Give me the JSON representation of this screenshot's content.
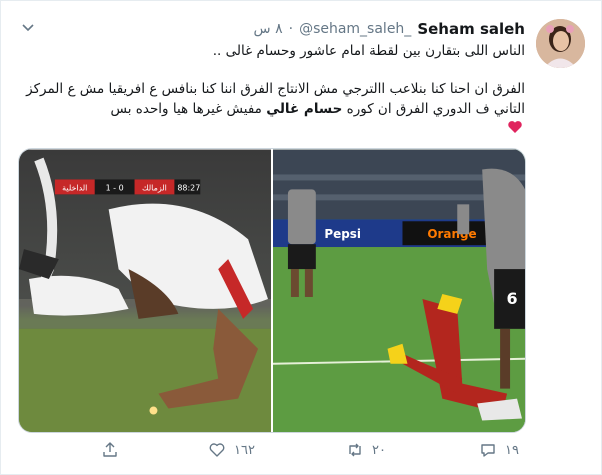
{
  "tweet": {
    "author_name": "Seham saleh",
    "author_handle": "@seham_saleh_",
    "separator": "·",
    "time": "٨ س",
    "text_line1": "الناس اللى بتقارن بين لقطة امام عاشور وحسام غالى ..",
    "text_para2_part1": "الفرق ان احنا كنا بنلاعب االترجي مش الانتاج الفرق اننا كنا بنافس ع افريقيا مش ع المركز التاني ف الدوري الفرق ان كوره ",
    "text_para2_bold": "حسام غالي",
    "text_para2_part2": " مفيش غيرها هيا واحده بس"
  },
  "media": {
    "left_image": {
      "scoreboard_minute": "88:27",
      "scoreboard_home": "الزمالك",
      "scoreboard_score": "1 - 0",
      "scoreboard_away": "الداخلية"
    },
    "right_image": {
      "banner_left": "Pepsi",
      "banner_right": "Orange",
      "shirt_number": "6"
    }
  },
  "actions": {
    "reply_count": "١٩",
    "retweet_count": "٢٠",
    "like_count": "١٦٢",
    "share_count": ""
  },
  "colors": {
    "text": "#14171a",
    "secondary": "#657786",
    "heart": "#e0245e",
    "border": "#e6ecf0"
  },
  "icons": [
    "caret-down-icon",
    "heart-emoji-icon",
    "reply-icon",
    "retweet-icon",
    "like-icon",
    "share-icon"
  ]
}
